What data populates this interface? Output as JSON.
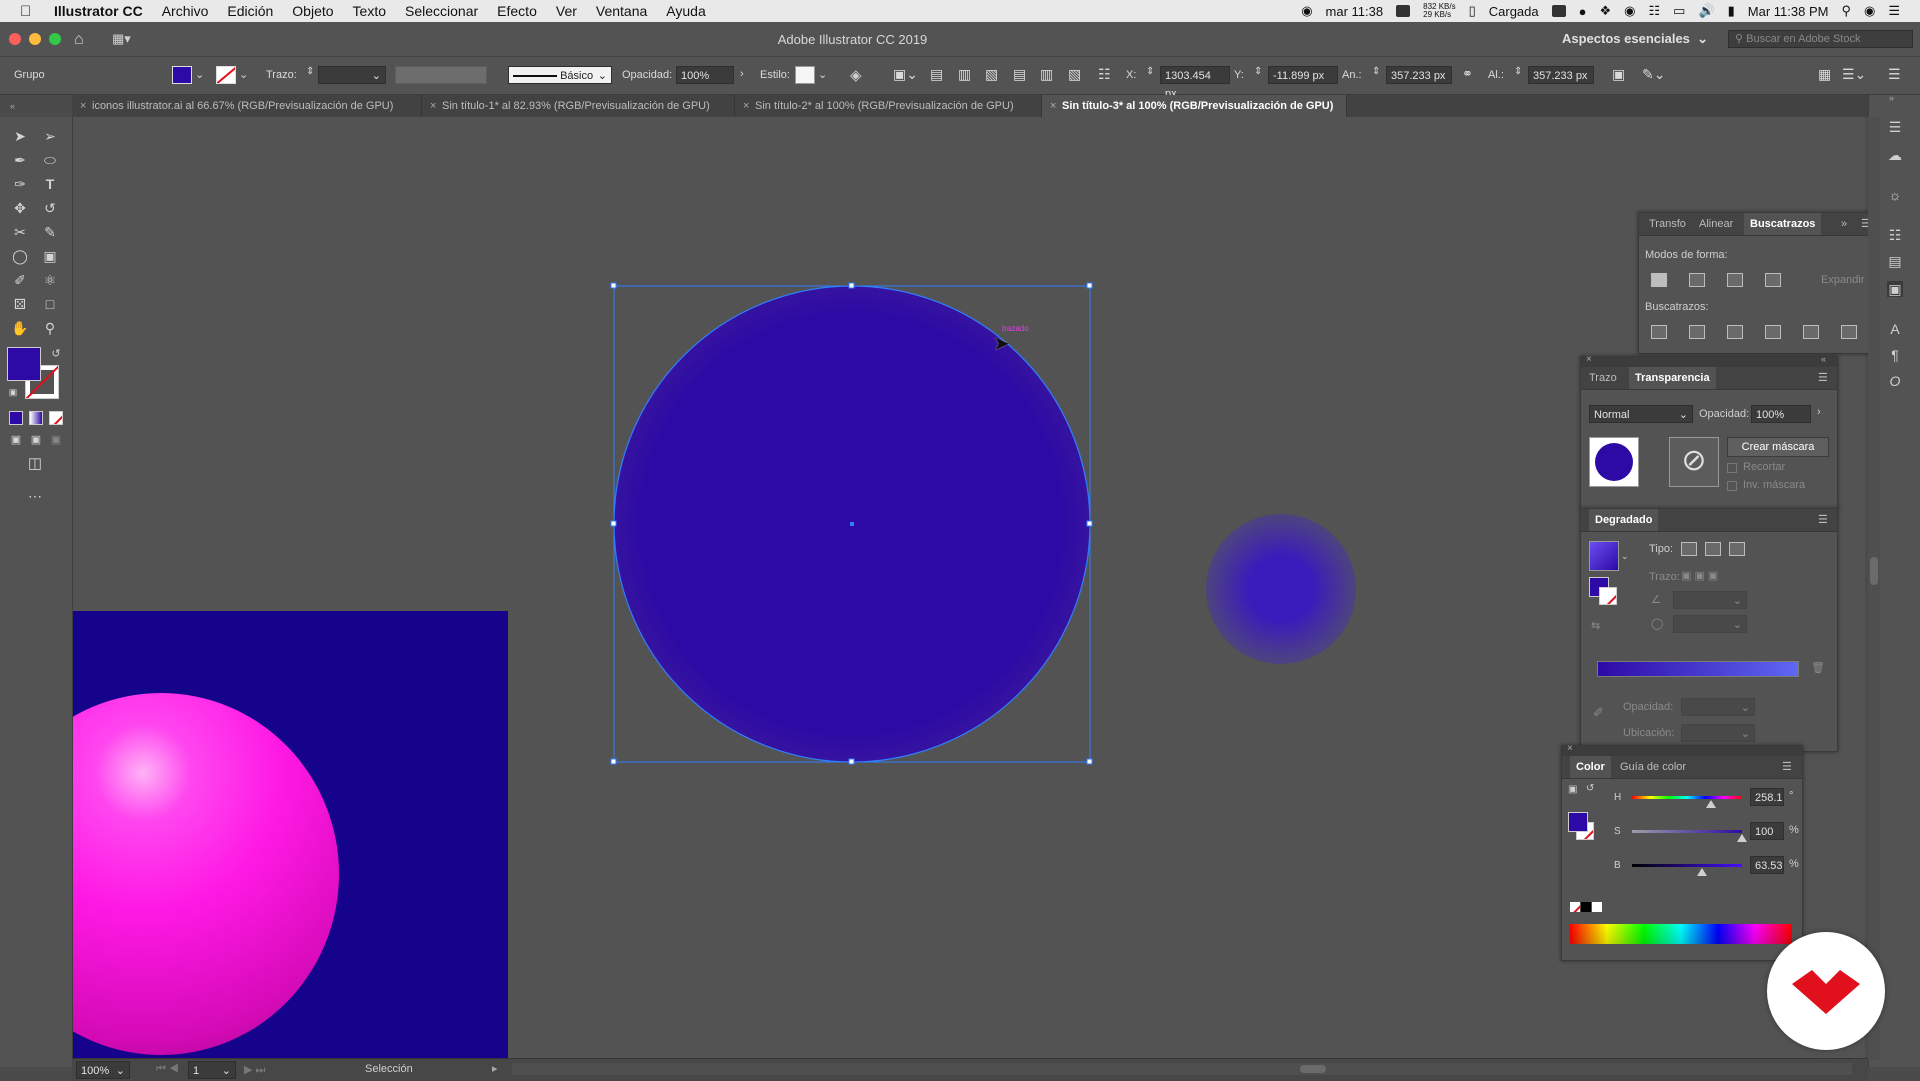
{
  "menubar": {
    "app": "Illustrator CC",
    "items": [
      "Archivo",
      "Edición",
      "Objeto",
      "Texto",
      "Seleccionar",
      "Efecto",
      "Ver",
      "Ventana",
      "Ayuda"
    ],
    "clock_left": "mar 11:38",
    "net_up": "832 KB/s",
    "net_down": "29 KB/s",
    "battery_label": "Cargada",
    "clock_right": "Mar 11:38 PM"
  },
  "titlebar": {
    "title": "Adobe Illustrator CC 2019",
    "workspace": "Aspectos esenciales",
    "search_placeholder": "Buscar en Adobe Stock"
  },
  "controlbar": {
    "selection_type": "Grupo",
    "stroke_label": "Trazo:",
    "stroke_profile": "Básico",
    "opacity_label": "Opacidad:",
    "opacity_value": "100%",
    "style_label": "Estilo:",
    "x_label": "X:",
    "x_value": "1303.454 px",
    "y_label": "Y:",
    "y_value": "-11.899 px",
    "w_label": "An.:",
    "w_value": "357.233 px",
    "h_label": "Al.:",
    "h_value": "357.233 px"
  },
  "tabs": [
    {
      "label": "iconos illustrator.ai al 66.67% (RGB/Previsualización de GPU)",
      "active": false
    },
    {
      "label": "Sin título-1* al 82.93% (RGB/Previsualización de GPU)",
      "active": false
    },
    {
      "label": "Sin título-2* al 100% (RGB/Previsualización de GPU)",
      "active": false
    },
    {
      "label": "Sin título-3* al 100% (RGB/Previsualización de GPU)",
      "active": true
    }
  ],
  "canvas": {
    "smart_guide_text": "trazado",
    "circle_color": "#2d0aa5",
    "artboard_bg": "#16038c",
    "sphere_color": "#ff19e4"
  },
  "pathfinder_panel": {
    "tabs": [
      "Transfo",
      "Alinear",
      "Buscatrazos"
    ],
    "active_tab": "Buscatrazos",
    "shape_modes_label": "Modos de forma:",
    "expand_button": "Expandir",
    "pathfinders_label": "Buscatrazos:"
  },
  "transparency_panel": {
    "tabs": [
      "Trazo",
      "Transparencia"
    ],
    "active_tab": "Transparencia",
    "blend_mode": "Normal",
    "opacity_label": "Opacidad:",
    "opacity_value": "100%",
    "make_mask_button": "Crear máscara",
    "clip_label": "Recortar",
    "invert_label": "Inv. máscara"
  },
  "gradient_panel": {
    "title": "Degradado",
    "type_label": "Tipo:",
    "stroke_label": "Trazo:",
    "opacity_label": "Opacidad:",
    "location_label": "Ubicación:"
  },
  "color_panel": {
    "tabs": [
      "Color",
      "Guía de color"
    ],
    "active_tab": "Color",
    "h_label": "H",
    "h_value": "258.1",
    "h_unit": "°",
    "s_label": "S",
    "s_value": "100",
    "s_unit": "%",
    "b_label": "B",
    "b_value": "63.53",
    "b_unit": "%",
    "h_fraction": 0.717,
    "s_fraction": 1.0,
    "b_fraction": 0.635
  },
  "statusbar": {
    "zoom": "100%",
    "artboard_number": "1",
    "tool_name": "Selección"
  },
  "colors": {
    "fill": "#2d0aa5",
    "ui_dark": "#535353",
    "selection_blue": "#2f7fff",
    "brand_red": "#e0101c"
  }
}
